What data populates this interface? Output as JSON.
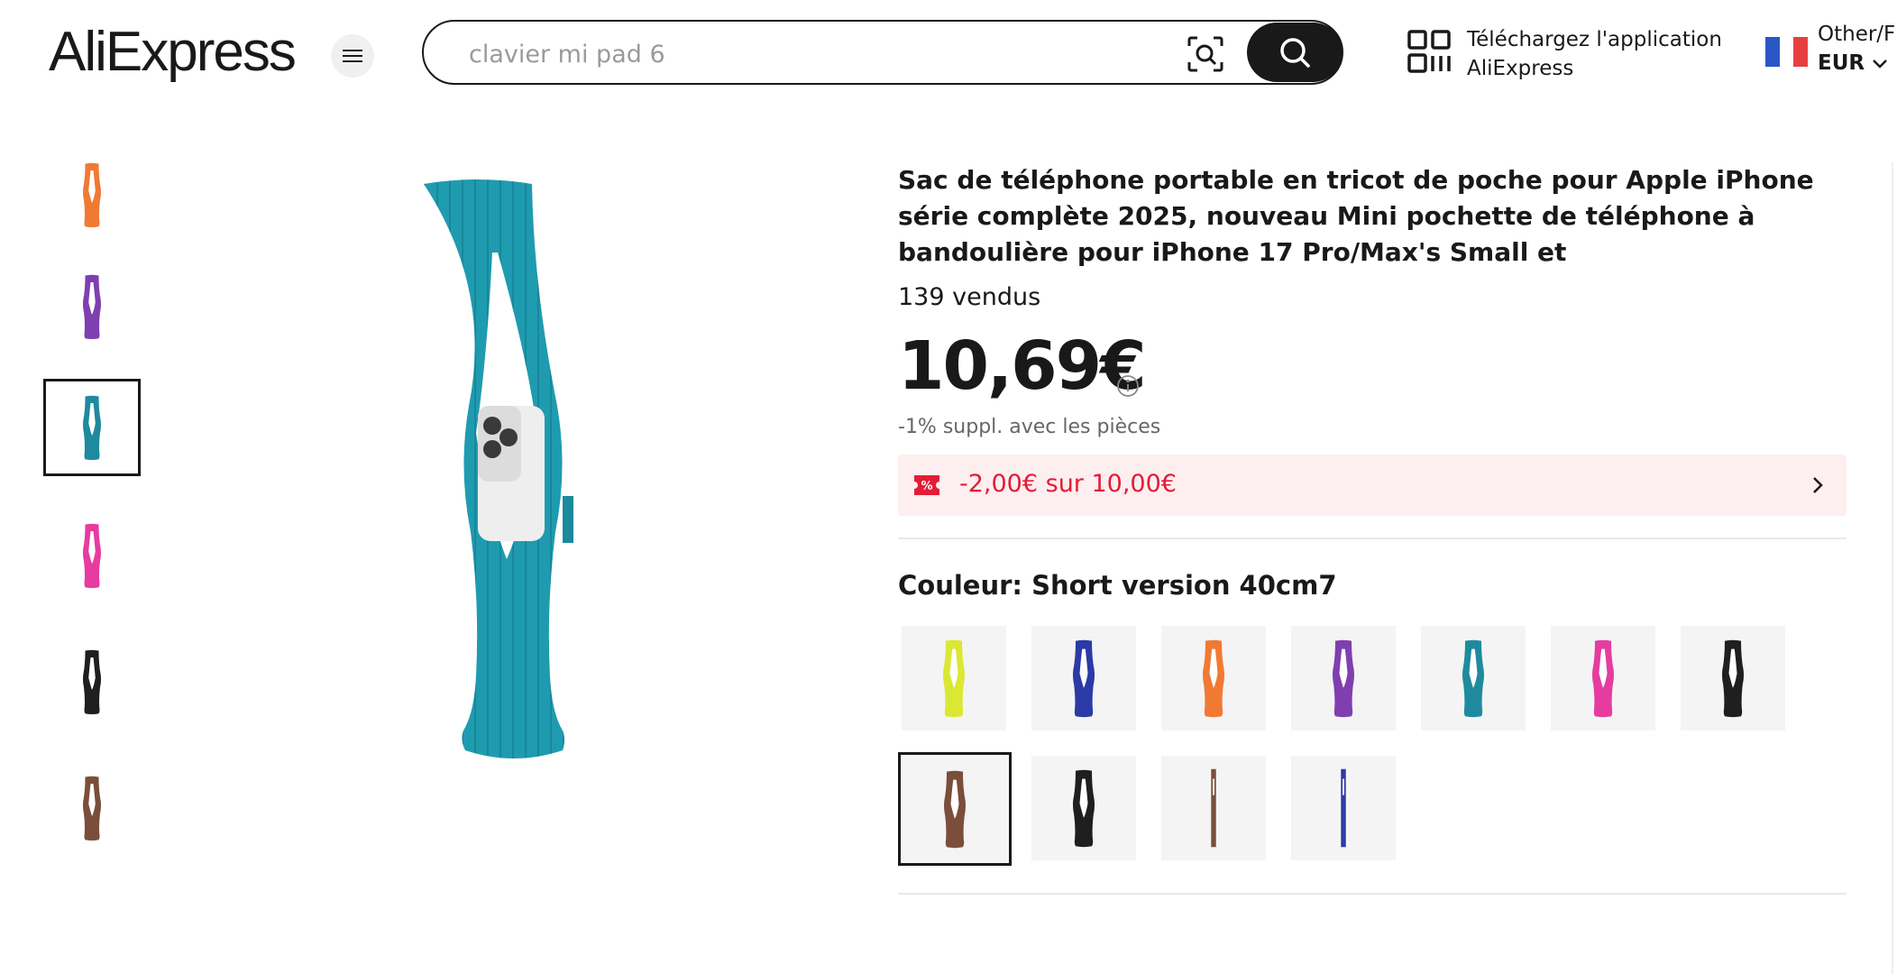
{
  "header": {
    "logo_text": "AliExpress",
    "search_placeholder": "clavier mi pad 6",
    "app_download_line1": "Téléchargez l'application",
    "app_download_line2": "AliExpress",
    "locale_line1": "Other/F",
    "currency": "EUR"
  },
  "gallery": {
    "thumbnails": [
      {
        "color": "#f07a34"
      },
      {
        "color": "#7f3fb0"
      },
      {
        "color": "#1f8a9e"
      },
      {
        "color": "#e63ca0"
      },
      {
        "color": "#1f1f1f"
      },
      {
        "color": "#7a4e3a"
      }
    ],
    "active_index": 2,
    "main_color": "#1f9bb0"
  },
  "product": {
    "title": "Sac de téléphone portable en tricot de poche pour Apple iPhone série complète 2025, nouveau Mini pochette de téléphone à bandoulière pour iPhone 17 Pro/Max's Small et",
    "sold": "139 vendus",
    "price": "10,69€",
    "coins_note": "-1% suppl. avec les pièces",
    "coupon_text": "-2,00€ sur 10,00€",
    "color_label": "Couleur: Short version 40cm7",
    "swatches": [
      {
        "color": "#dbe833",
        "variant": "regular"
      },
      {
        "color": "#2b3aa6",
        "variant": "regular"
      },
      {
        "color": "#f07a34",
        "variant": "regular"
      },
      {
        "color": "#7f3fb0",
        "variant": "regular"
      },
      {
        "color": "#1f8a9e",
        "variant": "regular"
      },
      {
        "color": "#e63ca0",
        "variant": "regular"
      },
      {
        "color": "#1f1f1f",
        "variant": "regular"
      },
      {
        "color": "#7a4e3a",
        "variant": "regular"
      },
      {
        "color": "#1f1f1f",
        "variant": "regular"
      },
      {
        "color": "#7a4e3a",
        "variant": "thin"
      },
      {
        "color": "#2b3aa6",
        "variant": "thin"
      }
    ],
    "selected_swatch_index": 7
  },
  "colors": {
    "accent_red": "#e31c35",
    "coupon_bg": "#fdeef0",
    "text_dark": "#191919"
  }
}
